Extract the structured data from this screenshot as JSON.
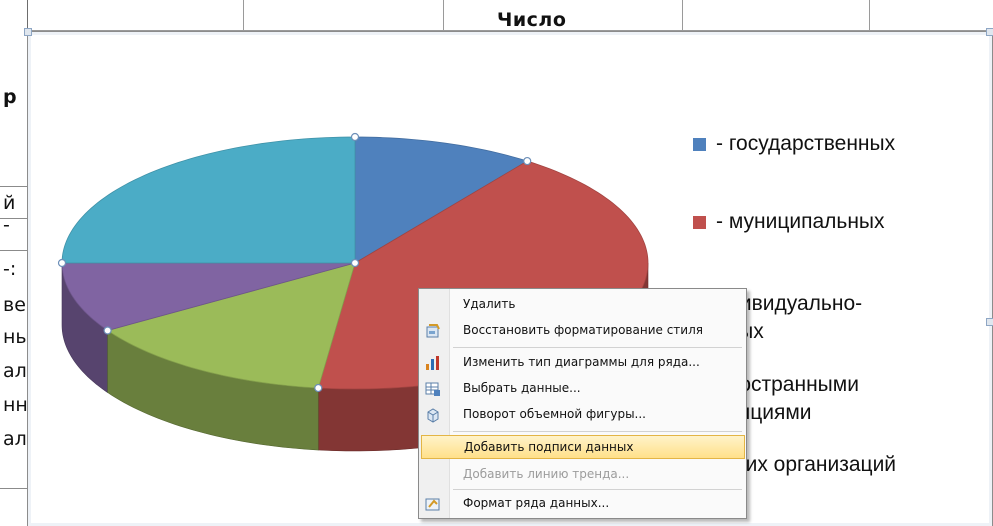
{
  "spreadsheet": {
    "column_header_text": "Число",
    "left_cells": [
      "р",
      "й -",
      "-:",
      "ве",
      "ны",
      "ал",
      "нн",
      "ал"
    ]
  },
  "legend": {
    "items": [
      {
        "line1": "- государственных",
        "line2": "",
        "color": "#4f81bd"
      },
      {
        "line1": "- муниципальных",
        "line2": "",
        "color": "#c0504d"
      },
      {
        "line1": "ндивидуально-",
        "line2": "сных",
        "color": "#9bbb59"
      },
      {
        "line1": "иностранными",
        "line2": "венциями",
        "color": "#8064a2"
      },
      {
        "line1": "ругих организаций",
        "line2": "",
        "color": "#4bacc6"
      }
    ]
  },
  "chart_data": {
    "type": "pie",
    "style": "3d",
    "categories": [
      "- государственных",
      "- муниципальных",
      "ндивидуально-сных",
      "иностранными венциями",
      "ругих организаций"
    ],
    "values": [
      10,
      42,
      14,
      9,
      25
    ],
    "colors": [
      "#4f81bd",
      "#c0504d",
      "#9bbb59",
      "#8064a2",
      "#4bacc6"
    ],
    "legend_position": "right"
  },
  "context_menu": {
    "items": [
      {
        "label": "Удалить",
        "icon": "",
        "state": "normal"
      },
      {
        "label": "Восстановить форматирование стиля",
        "icon": "reset-style-icon",
        "state": "normal"
      },
      {
        "label": "Изменить тип диаграммы для ряда...",
        "icon": "chart-type-icon",
        "state": "normal"
      },
      {
        "label": "Выбрать данные...",
        "icon": "select-data-icon",
        "state": "normal"
      },
      {
        "label": "Поворот объемной фигуры...",
        "icon": "3d-rotation-icon",
        "state": "normal"
      },
      {
        "label": "Добавить подписи данных",
        "icon": "",
        "state": "hover"
      },
      {
        "label": "Добавить линию тренда...",
        "icon": "",
        "state": "disabled"
      },
      {
        "label": "Формат ряда данных...",
        "icon": "format-series-icon",
        "state": "normal"
      }
    ]
  }
}
